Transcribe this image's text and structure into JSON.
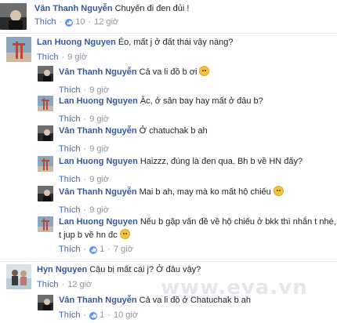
{
  "comments": [
    {
      "name": "Vân Thanh Nguyễn",
      "text": "Chuyến đi đen đủi !",
      "like": "Thích",
      "likes": "10",
      "time": "12 giờ"
    },
    {
      "name": "Lan Huong Nguyen",
      "text": "Éo, mất j ở đất thái vậy nàng?",
      "like": "Thích",
      "time": "9 giờ"
    },
    {
      "name": "Vân Thanh Nguyễn",
      "text": "Cả va li đồ b ơi",
      "emoji": "crying-face",
      "like": "Thích",
      "time": "9 giờ"
    },
    {
      "name": "Lan Huong Nguyen",
      "text": "Ặc, ở sân bay hay mất ở đâu b?",
      "like": "Thích",
      "time": "9 giờ"
    },
    {
      "name": "Vân Thanh Nguyễn",
      "text": "Ở chatuchak b ah",
      "like": "Thích",
      "time": "9 giờ"
    },
    {
      "name": "Lan Huong Nguyen",
      "text": "Haizzz, đúng là đen qua. Bh b về HN đấy?",
      "like": "Thích",
      "time": "9 giờ"
    },
    {
      "name": "Vân Thanh Nguyễn",
      "text": "Mai b ah, may mà ko mất hộ chiếu",
      "emoji": "sweat-face",
      "like": "Thích",
      "time": "9 giờ"
    },
    {
      "name": "Lan Huong Nguyen",
      "text": "Nếu b gặp vấn đề về hộ chiếu ở bkk thì nhắn t nhé,",
      "text2": "t jup b về hn đc",
      "emoji": "smile-face",
      "like": "Thích",
      "likes": "1",
      "time": "7 giờ"
    },
    {
      "name": "Hyn Nguyen",
      "text": "Cậu bị mất cái j? Ở đâu vậy?",
      "like": "Thích",
      "time": "12 giờ"
    },
    {
      "name": "Vân Thanh Nguyễn",
      "text": "Cả va li đồ ở Chatuchak b ah",
      "like": "Thích",
      "likes": "1",
      "time": "10 giờ"
    }
  ],
  "watermark": "www.eva.vn",
  "colors": {
    "link": "#365899",
    "like": "#4267b2",
    "meta": "#90949c",
    "thumb": "#5890ff"
  }
}
